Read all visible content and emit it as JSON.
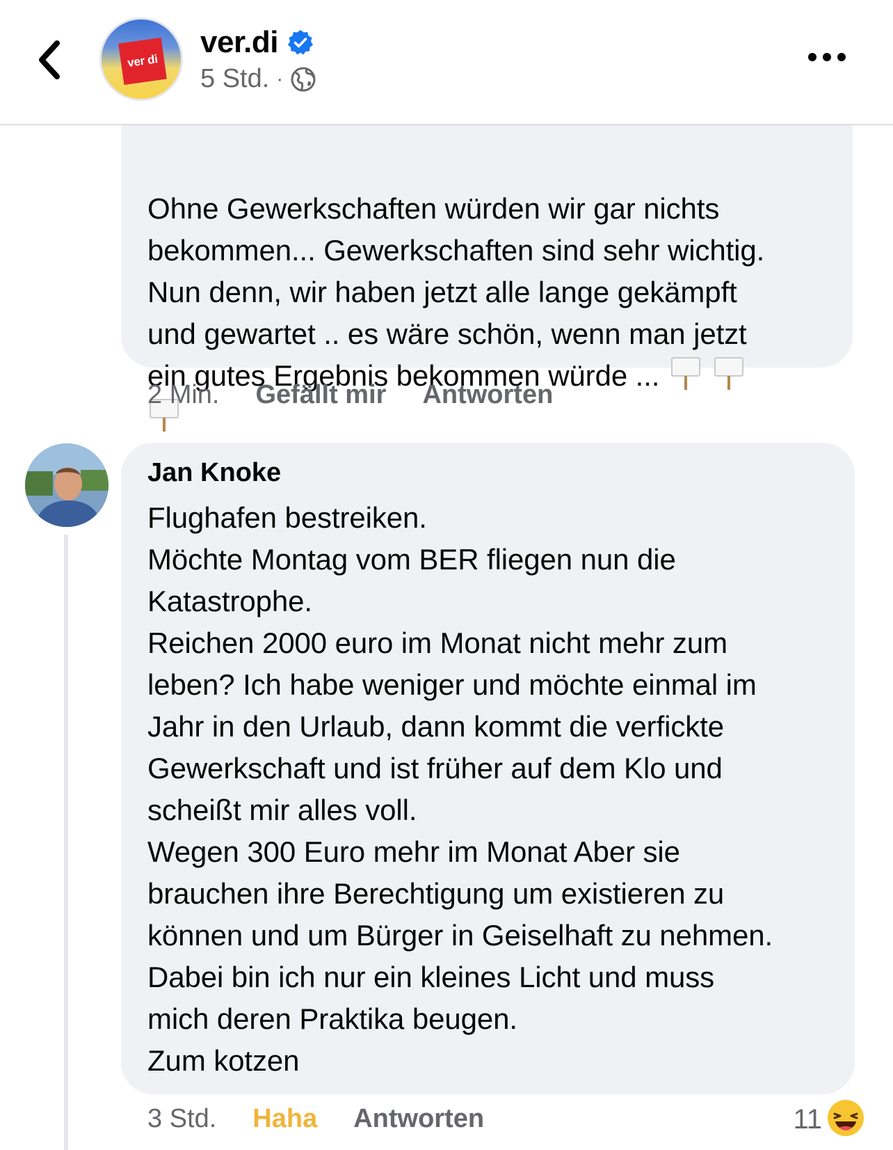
{
  "header": {
    "page_name": "ver.di",
    "post_time": "5 Std.",
    "separator": "·",
    "logo_text": "ver di"
  },
  "comments": [
    {
      "lines": [
        "Ohne Gewerkschaften würden wir gar nichts",
        "bekommen... Gewerkschaften sind sehr wichtig.",
        "Nun denn, wir haben jetzt alle lange gekämpft",
        "und gewartet .. es wäre schön, wenn man jetzt",
        "ein gutes Ergebnis bekommen würde ..."
      ],
      "time": "2 Min.",
      "like_label": "Gefällt mir",
      "reply_label": "Antworten"
    },
    {
      "author": "Jan Knoke",
      "lines": [
        "Flughafen bestreiken.",
        "Möchte Montag vom BER fliegen nun die",
        "Katastrophe.",
        "Reichen 2000 euro im Monat nicht mehr zum",
        "leben? Ich habe weniger und möchte einmal im",
        "Jahr in den Urlaub, dann kommt die verfickte",
        "Gewerkschaft und ist früher auf dem Klo und",
        "scheißt mir alles voll.",
        "Wegen 300 Euro mehr im Monat Aber sie",
        "brauchen ihre Berechtigung um existieren zu",
        "können und um Bürger in Geiselhaft zu nehmen.",
        "Dabei bin ich nur ein kleines Licht und muss",
        "mich deren Praktika beugen.",
        "Zum kotzen"
      ],
      "time": "3 Std.",
      "reaction_label": "Haha",
      "reply_label": "Antworten",
      "reaction_count": "11"
    }
  ],
  "colors": {
    "bubble": "#f0f1f5",
    "secondary_text": "#65676b",
    "haha": "#f0b43c",
    "verified": "#1877f2"
  },
  "icons": [
    "back-chevron-icon",
    "verified-badge-icon",
    "globe-icon",
    "more-options-icon",
    "placard-icon",
    "laughing-emoji-icon"
  ]
}
